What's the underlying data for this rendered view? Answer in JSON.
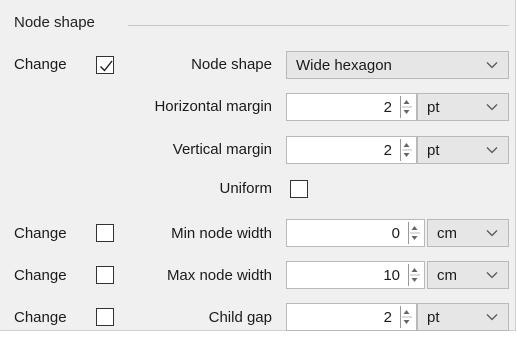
{
  "group": {
    "title": "Node shape"
  },
  "rows": {
    "shape": {
      "change_label": "Change",
      "change_checked": true,
      "label": "Node shape",
      "value": "Wide hexagon"
    },
    "hmargin": {
      "label": "Horizontal margin",
      "value": "2",
      "unit": "pt"
    },
    "vmargin": {
      "label": "Vertical margin",
      "value": "2",
      "unit": "pt"
    },
    "uniform": {
      "label": "Uniform",
      "checked": false
    },
    "minwidth": {
      "change_label": "Change",
      "change_checked": false,
      "label": "Min node width",
      "value": "0",
      "unit": "cm"
    },
    "maxwidth": {
      "change_label": "Change",
      "change_checked": false,
      "label": "Max node width",
      "value": "10",
      "unit": "cm"
    },
    "childgap": {
      "change_label": "Change",
      "change_checked": false,
      "label": "Child gap",
      "value": "2",
      "unit": "pt"
    }
  },
  "icons": {
    "checkmark": "check-icon",
    "dropdown": "chevron-down-icon",
    "spin": "spin-arrows-icon"
  },
  "colors": {
    "panel_bg": "#f0f0f0",
    "combo_bg": "#e6e6e6",
    "border": "#b9b9b9"
  }
}
